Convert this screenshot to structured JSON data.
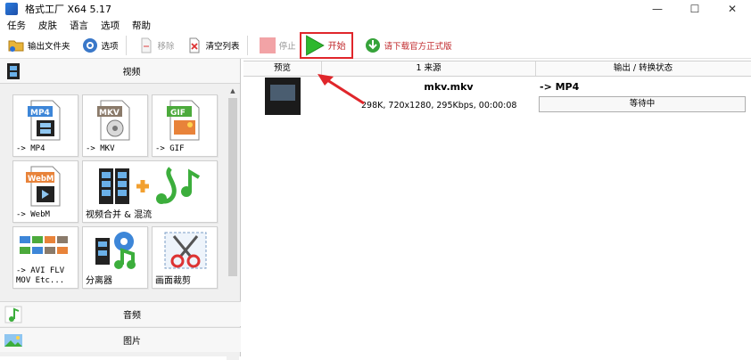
{
  "window": {
    "title": "格式工厂 X64 5.17",
    "controls": [
      "—",
      "☐",
      "✕"
    ]
  },
  "menu": [
    "任务",
    "皮肤",
    "语言",
    "选项",
    "帮助"
  ],
  "toolbar": {
    "output_folder": "输出文件夹",
    "options": "选项",
    "remove": "移除",
    "clear_list": "清空列表",
    "stop": "停止",
    "start": "开始",
    "download": "请下载官方正式版"
  },
  "left": {
    "video_category": "视频",
    "audio_category": "音频",
    "image_category": "图片",
    "tiles": [
      {
        "badge": "MP4",
        "label": "-> MP4"
      },
      {
        "badge": "MKV",
        "label": "-> MKV"
      },
      {
        "badge": "GIF",
        "label": "-> GIF"
      },
      {
        "badge": "WebM",
        "label": "-> WebM"
      },
      {
        "label": "视频合并 & 混流"
      },
      {
        "label": "-> AVI FLV\nMOV Etc..."
      },
      {
        "label": "分离器"
      },
      {
        "label": "画面裁剪"
      }
    ]
  },
  "table": {
    "headers": [
      "预览",
      "1 来源",
      "输出 / 转换状态"
    ],
    "rows": [
      {
        "filename": "mkv.mkv",
        "info": "298K, 720x1280, 295Kbps, 00:00:08",
        "output": "-> MP4",
        "status": "等待中"
      }
    ]
  },
  "colors": {
    "highlight_red": "#e0262b",
    "play_green": "#2eb82e"
  }
}
